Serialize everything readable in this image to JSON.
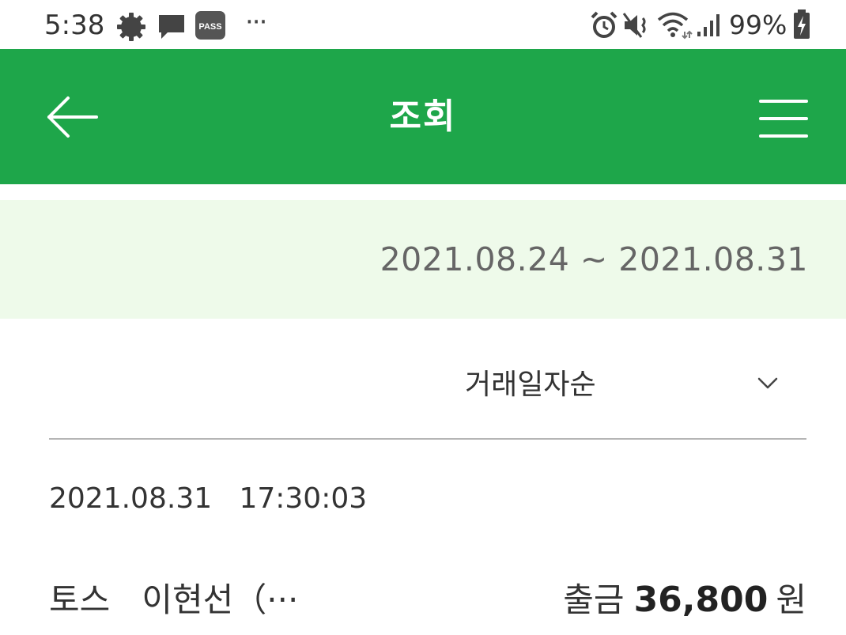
{
  "status_bar": {
    "time": "5:38",
    "battery": "99%",
    "icons": [
      "settings-gear-icon",
      "message-icon",
      "pass-app-icon",
      "more-dots-icon",
      "alarm-icon",
      "mute-vibrate-icon",
      "wifi-icon",
      "signal-icon",
      "battery-charging-icon"
    ],
    "pass_label": "PASS",
    "more": "···"
  },
  "app_bar": {
    "title": "조회",
    "background": "#1ea64a"
  },
  "period": {
    "text": "2021.08.24 ~ 2021.08.31",
    "background": "#eefaea"
  },
  "sort": {
    "selected": "거래일자순"
  },
  "transactions": [
    {
      "datetime": "2021.08.31   17:30:03",
      "description": "토스   이현선（···",
      "type": "출금",
      "amount": "36,800",
      "currency": "원"
    }
  ]
}
